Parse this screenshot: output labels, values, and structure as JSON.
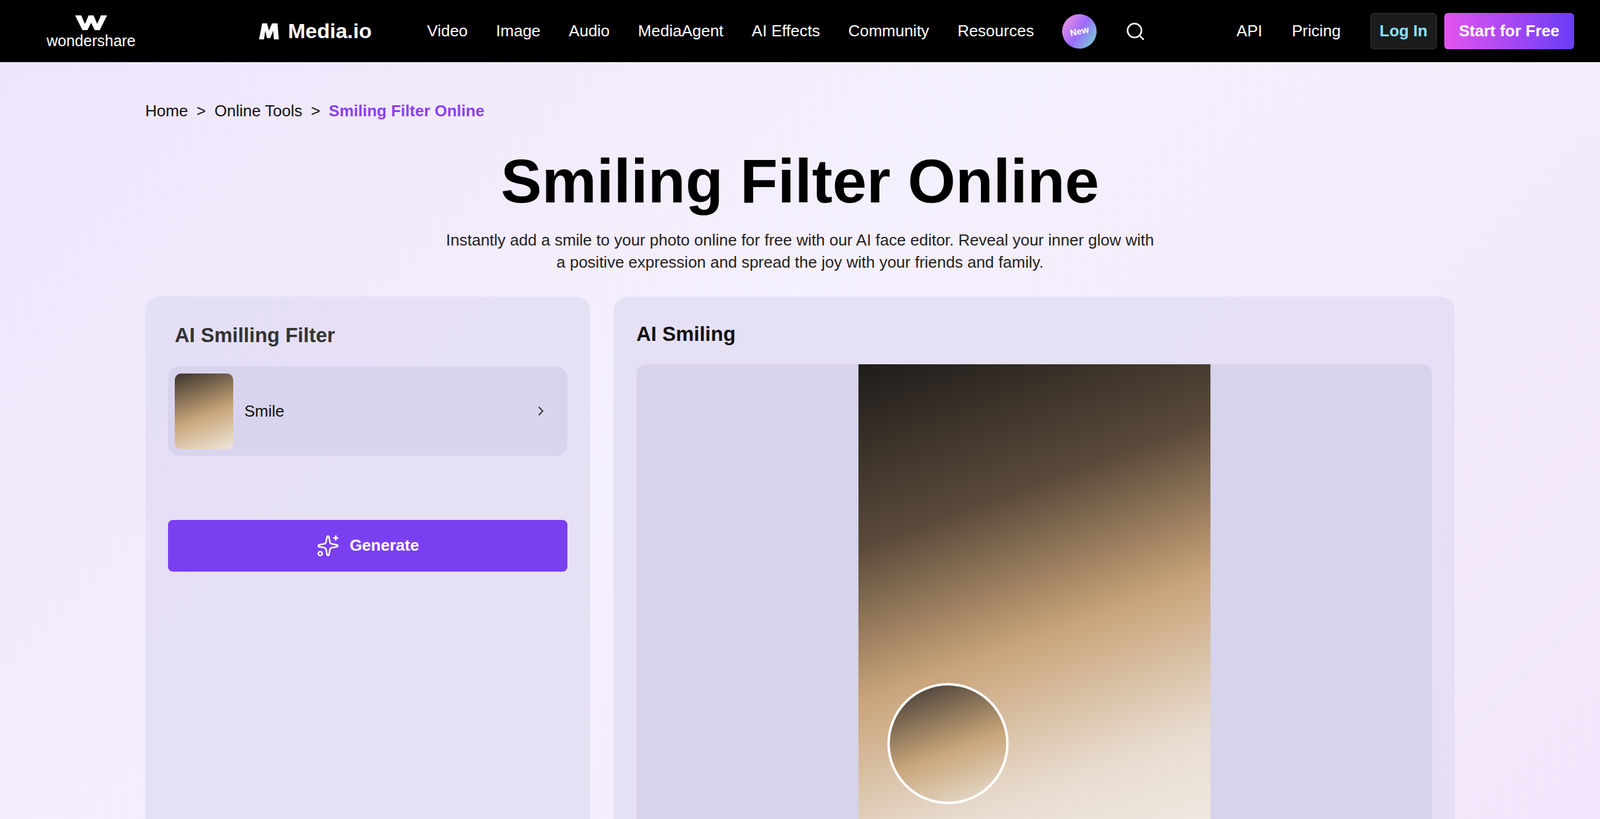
{
  "header": {
    "brand": "wondershare",
    "product": "Media.io",
    "nav": [
      "Video",
      "Image",
      "Audio",
      "MediaAgent",
      "AI Effects",
      "Community",
      "Resources"
    ],
    "badge": "New",
    "right_links": [
      "API",
      "Pricing"
    ],
    "login": "Log In",
    "cta": "Start for Free"
  },
  "breadcrumb": [
    {
      "label": "Home",
      "selected": false
    },
    {
      "label": "Online Tools",
      "selected": false
    },
    {
      "label": "Smiling Filter Online",
      "selected": true
    }
  ],
  "separator": ">",
  "title": "Smiling Filter Online",
  "subtitle": "Instantly add a smile to your photo online for free with our AI face editor. Reveal your inner glow with a positive expression and spread the joy with your friends and family.",
  "left_panel": {
    "title": "AI Smilling Filter",
    "filters": [
      {
        "label": "Smile"
      }
    ],
    "button": "Generate"
  },
  "right_panel": {
    "title": "AI Smiling"
  }
}
